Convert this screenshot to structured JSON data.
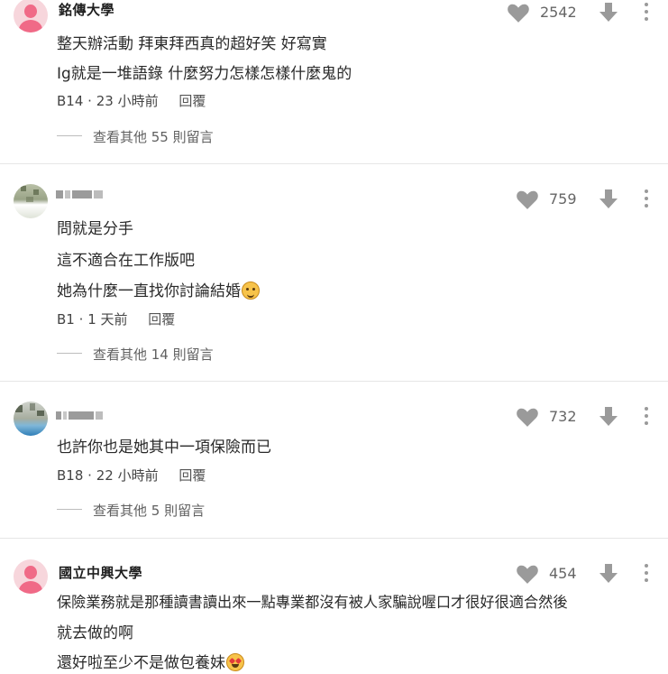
{
  "comments": [
    {
      "username": "銘傳大學",
      "likes": "2542",
      "lines": [
        "整天辦活動 拜東拜西真的超好笑 好寫實",
        "Ig就是一堆語錄 什麼努力怎樣怎樣什麼鬼的"
      ],
      "floor": "B14",
      "sep": "·",
      "time": "23 小時前",
      "reply": "回覆",
      "more": "查看其他 55 則留言"
    },
    {
      "likes": "759",
      "lines": [
        "問就是分手",
        "這不適合在工作版吧",
        "她為什麼一直找你討論結婚"
      ],
      "floor": "B1",
      "sep": "·",
      "time": "1 天前",
      "reply": "回覆",
      "more": "查看其他 14 則留言"
    },
    {
      "likes": "732",
      "lines": [
        "也許你也是她其中一項保險而已"
      ],
      "floor": "B18",
      "sep": "·",
      "time": "22 小時前",
      "reply": "回覆",
      "more": "查看其他 5 則留言"
    },
    {
      "username": "國立中興大學",
      "likes": "454",
      "lines": [
        "保險業務就是那種讀書讀出來一點專業都沒有被人家騙說喔口才很好很適合然後",
        "就去做的啊",
        "還好啦至少不是做包養妹"
      ]
    }
  ],
  "icons": {
    "like": "heart-icon",
    "dislike": "arrow-down-icon",
    "menu": "more-vertical-icon",
    "emoji_1": "smiling-face-emoji",
    "emoji_2": "star-struck-emoji"
  },
  "colors": {
    "icon_gray": "#9a9a9a",
    "avatar_pink": "#f06a87",
    "avatar_pink_bg": "#f7d6dc",
    "divider": "#e6e6e6"
  }
}
